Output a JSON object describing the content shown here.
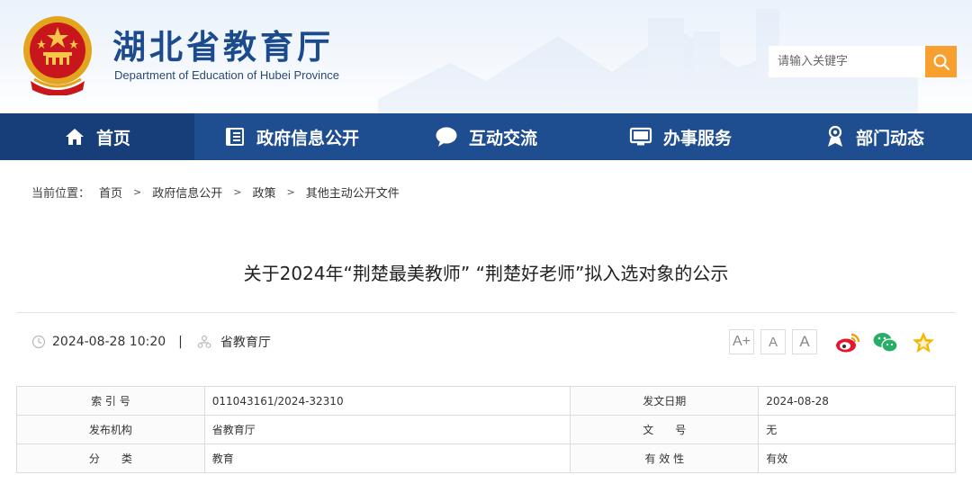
{
  "header": {
    "site_name": "湖北省教育厅",
    "site_name_en": "Department of Education of Hubei Province",
    "search_placeholder": "请输入关键字"
  },
  "nav": {
    "items": [
      {
        "label": "首页",
        "icon": "home-icon"
      },
      {
        "label": "政府信息公开",
        "icon": "document-icon"
      },
      {
        "label": "互动交流",
        "icon": "chat-bubble-icon"
      },
      {
        "label": "办事服务",
        "icon": "monitor-icon"
      },
      {
        "label": "部门动态",
        "icon": "location-pin-icon"
      }
    ]
  },
  "breadcrumb": {
    "prefix": "当前位置：",
    "items": [
      "首页",
      "政府信息公开",
      "政策",
      "其他主动公开文件"
    ]
  },
  "article": {
    "title": "关于2024年“荆楚最美教师” “荆楚好老师”拟入选对象的公示",
    "datetime": "2024-08-28 10:20",
    "separator": "|",
    "source": "省教育厅",
    "font_sizes": [
      "A+",
      "A",
      "A"
    ]
  },
  "info_table": {
    "rows": [
      {
        "k1": "索 引 号",
        "v1": "011043161/2024-32310",
        "k2": "发文日期",
        "v2": "2024-08-28"
      },
      {
        "k1": "发布机构",
        "v1": "省教育厅",
        "k2": "文　　号",
        "v2": "无"
      },
      {
        "k1": "分　　类",
        "v1": "教育",
        "k2": "有 效 性",
        "v2": "有效"
      }
    ]
  },
  "colors": {
    "nav_bg": "#1e4d90",
    "brand_text": "#1b4a8d",
    "search_button": "#f7a030",
    "weibo": "#e6162d",
    "wechat": "#2aae67",
    "favorite": "#f7b500"
  }
}
